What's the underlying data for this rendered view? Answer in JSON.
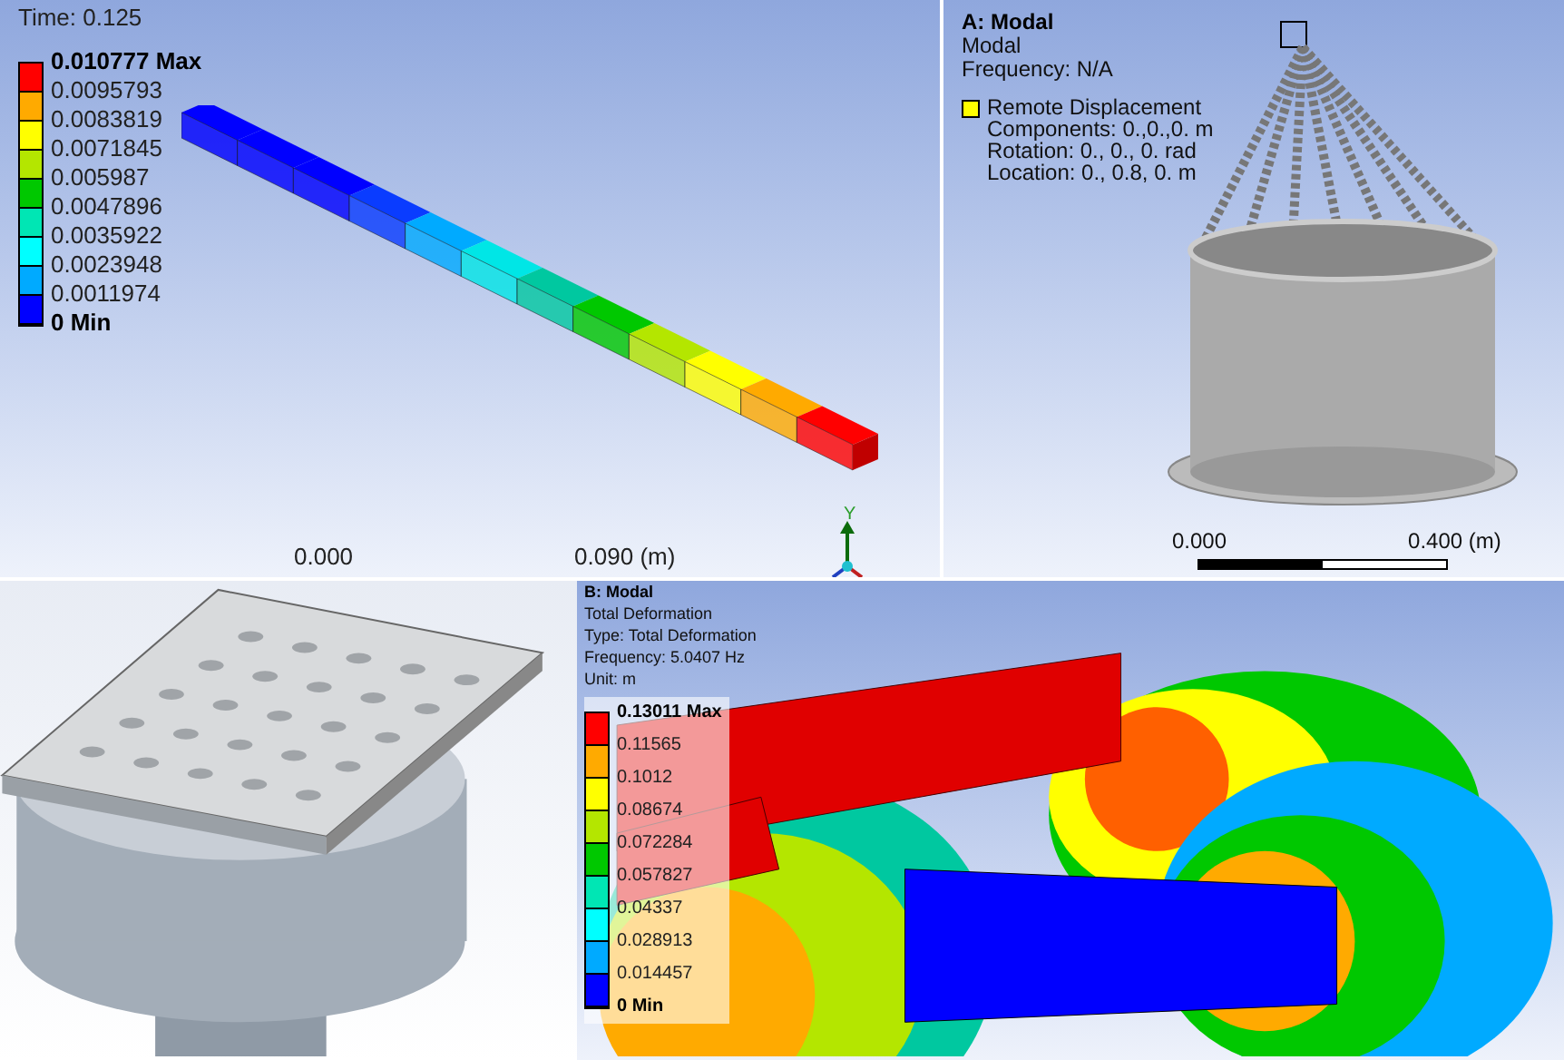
{
  "panel_a": {
    "time": "Time: 0.125",
    "legend": {
      "labels": [
        "0.010777 Max",
        "0.0095793",
        "0.0083819",
        "0.0071845",
        "0.005987",
        "0.0047896",
        "0.0035922",
        "0.0023948",
        "0.0011974",
        "0 Min"
      ],
      "bands": [
        {
          "color": "#ff0000"
        },
        {
          "color": "#ffaa00"
        },
        {
          "color": "#ffff00"
        },
        {
          "color": "#b4e600"
        },
        {
          "color": "#00c800"
        },
        {
          "color": "#00e6b4"
        },
        {
          "color": "#00ffff"
        },
        {
          "color": "#00aaff"
        },
        {
          "color": "#0000ff"
        }
      ]
    },
    "scale": [
      "0.000",
      "0.090 (m)"
    ],
    "axis_label": "Y"
  },
  "panel_b": {
    "title": "A: Modal",
    "lines": [
      "Modal",
      "Frequency: N/A"
    ],
    "boundary": {
      "name": "Remote Displacement",
      "color": "#ffff00",
      "lines": [
        "Components: 0.,0.,0. m",
        "Rotation: 0., 0., 0. rad",
        "Location: 0., 0.8, 0. m"
      ]
    },
    "scale": [
      "0.000",
      "0.400 (m)"
    ]
  },
  "panel_d": {
    "title": "B: Modal",
    "lines": [
      "Total Deformation",
      "Type: Total Deformation",
      "Frequency: 5.0407 Hz",
      "Unit: m"
    ],
    "legend": {
      "labels": [
        "0.13011 Max",
        "0.11565",
        "0.1012",
        "0.08674",
        "0.072284",
        "0.057827",
        "0.04337",
        "0.028913",
        "0.014457",
        "0 Min"
      ],
      "bands": [
        {
          "color": "#ff0000"
        },
        {
          "color": "#ffaa00"
        },
        {
          "color": "#ffff00"
        },
        {
          "color": "#b4e600"
        },
        {
          "color": "#00c800"
        },
        {
          "color": "#00e6b4"
        },
        {
          "color": "#00ffff"
        },
        {
          "color": "#00aaff"
        },
        {
          "color": "#0000ff"
        }
      ]
    }
  }
}
